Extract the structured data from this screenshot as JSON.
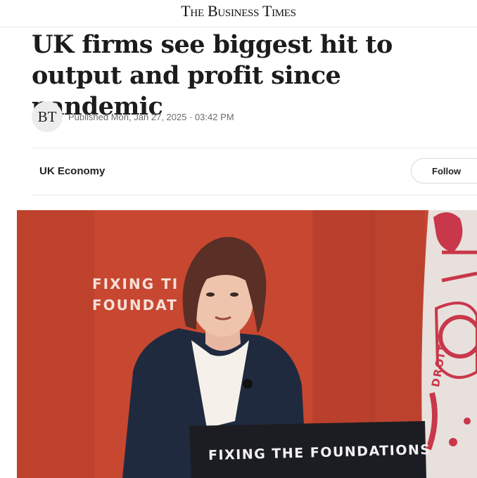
{
  "masthead": {
    "title": "The Business Times"
  },
  "article": {
    "headline": "UK firms see biggest hit to output and profit since pandemic",
    "author_initials": "BT",
    "published": "Published Mon, Jan 27, 2025 · 03:42 PM"
  },
  "topic": {
    "label": "UK Economy",
    "follow_label": "Follow"
  },
  "image": {
    "backdrop_text_line1": "FIXING TI",
    "backdrop_text_line2": "FOUNDAT",
    "podium_text": "FIXING THE FOUNDATIONS",
    "flag_text": "DROIT",
    "colors": {
      "backdrop": "#c84730",
      "jacket": "#1f2a3f",
      "podium": "#1b1d22"
    }
  }
}
